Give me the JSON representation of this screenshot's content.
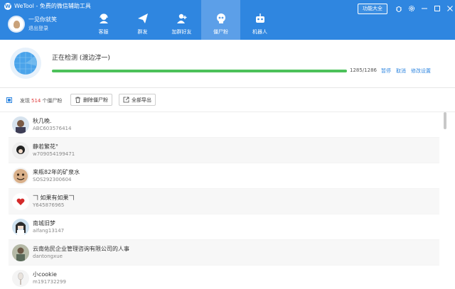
{
  "app": {
    "title": "WeTool - 免费的微信辅助工具"
  },
  "user": {
    "name": "一见你就笑",
    "logout": "退出登录"
  },
  "nav": [
    {
      "label": "客服",
      "icon": "customer-service-icon"
    },
    {
      "label": "群发",
      "icon": "paper-plane-icon"
    },
    {
      "label": "加群好友",
      "icon": "add-friend-icon"
    },
    {
      "label": "僵尸粉",
      "icon": "skull-icon",
      "active": true
    },
    {
      "label": "机器人",
      "icon": "robot-icon"
    }
  ],
  "header": {
    "feature_button": "功能大全"
  },
  "scan": {
    "status": "正在检测 (渡边淳一)",
    "progress": 0.999,
    "count": "1285/1286",
    "actions": {
      "pause": "暂停",
      "cancel": "取消",
      "settings": "修改设置"
    }
  },
  "toolbar": {
    "found_prefix": "发现",
    "found_count": "514",
    "found_suffix": "个僵尸粉",
    "delete_label": "删除僵尸粉",
    "export_label": "全部导出"
  },
  "contacts": [
    {
      "name": "秋几晚.",
      "id": "ABC603576414"
    },
    {
      "name": "静若繁花°",
      "id": "w709054199471"
    },
    {
      "name": "来瓶82年的矿泉水",
      "id": "SOS292300604"
    },
    {
      "name": "𠃍 如果有如果𠃍",
      "id": "Y645876965"
    },
    {
      "name": "南城旧梦",
      "id": "aifang13147"
    },
    {
      "name": "云南佑民企业管理咨询有限公司的人事",
      "id": "dantongxue"
    },
    {
      "name": "小cookie",
      "id": "m191732299"
    }
  ],
  "colors": {
    "header": "#2f86e0",
    "progress": "#4cc15a",
    "accent": "#2f86e0",
    "count_red": "#e03a3a"
  }
}
